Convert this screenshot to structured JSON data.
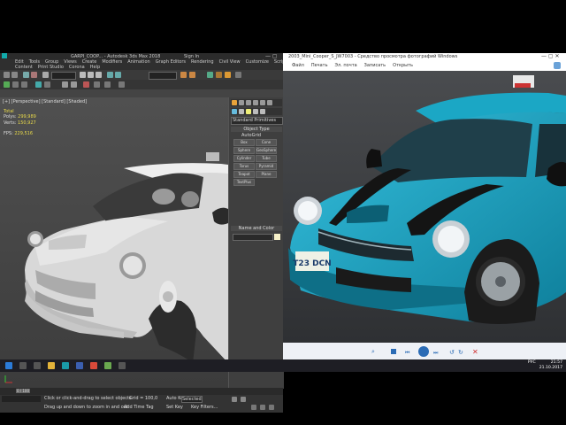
{
  "max": {
    "title": "GARPI_COOP... - Autodesk 3ds Max 2018",
    "signin": "Sign In",
    "menu1": [
      "Edit",
      "Tools",
      "Group",
      "Views",
      "Create",
      "Modifiers",
      "Animation",
      "Graph Editors",
      "Rendering",
      "Civil View",
      "Customize",
      "Scripting",
      "Content"
    ],
    "menu2": [
      "Content",
      "Print Studio",
      "Corona",
      "Help"
    ],
    "viewport_label": "[+] [Perspective] [Standard] [Shaded]",
    "stats": {
      "total_label": "Total",
      "polys_label": "Polys:",
      "polys": "299,989",
      "verts_label": "Verts:",
      "verts": "150,927",
      "fps_label": "FPS:",
      "fps": "229,516"
    },
    "cmd": {
      "category": "Standard Primitives",
      "object_type": "Object Type",
      "autogrid": "AutoGrid",
      "buttons": [
        "Box",
        "Cone",
        "Sphere",
        "GeoSphere",
        "Cylinder",
        "Tube",
        "Torus",
        "Pyramid",
        "Teapot",
        "Plane",
        "TextPlus"
      ],
      "name_color": "Name and Color"
    },
    "timeline": "0 / 100",
    "status_msg": "Click or click-and-drag to select objects",
    "status_msg2": "Drag up and down to zoom in and out",
    "add_time_tag": "Add Time Tag",
    "grid": "Grid = 100,0",
    "autokey": "Auto Key",
    "selected": "Selected",
    "setkey": "Set Key",
    "key_filters": "Key Filters..."
  },
  "viewer": {
    "title": "2003_Mini_Cooper_S_JW7003 - Средство просмотра фотографий Windows",
    "menu": [
      "Файл",
      "Печать",
      "Эл. почта",
      "Записать",
      "Открыть"
    ]
  },
  "car": {
    "plate": "T23 DCN"
  },
  "tray": {
    "lang": "РУС",
    "time": "21:57",
    "date": "21.10.2017"
  },
  "colors": {
    "max_bg": "#444444",
    "viewer_bg": "#ffffff",
    "car_blue": "#1aa6c4",
    "taskbar": "#1e1e24"
  }
}
